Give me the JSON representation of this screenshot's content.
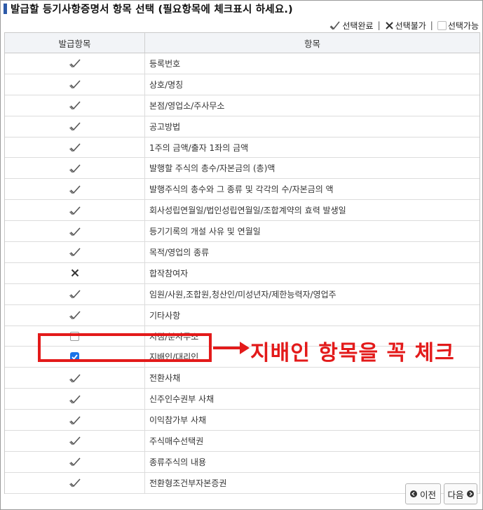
{
  "title": "발급할 등기사항증명서 항목 선택 (필요항목에 체크표시 하세요.)",
  "legend": {
    "completed": "선택완료",
    "unavailable": "선택불가",
    "available": "선택가능"
  },
  "table": {
    "headers": [
      "발급항목",
      "항목"
    ],
    "rows": [
      {
        "state": "completed",
        "label": "등록번호"
      },
      {
        "state": "completed",
        "label": "상호/명칭"
      },
      {
        "state": "completed",
        "label": "본점/영업소/주사무소"
      },
      {
        "state": "completed",
        "label": "공고방법"
      },
      {
        "state": "completed",
        "label": "1주의 금액/출자 1좌의 금액"
      },
      {
        "state": "completed",
        "label": "발행할 주식의 총수/자본금의 (총)액"
      },
      {
        "state": "completed",
        "label": "발행주식의 총수와 그 종류 및 각각의 수/자본금의 액"
      },
      {
        "state": "completed",
        "label": "회사성립연월일/법인성립연월일/조합계약의 효력 발생일"
      },
      {
        "state": "completed",
        "label": "등기기록의 개설 사유 및 연월일"
      },
      {
        "state": "completed",
        "label": "목적/영업의 종류"
      },
      {
        "state": "unavailable",
        "label": "합작참여자"
      },
      {
        "state": "completed",
        "label": "임원/사원,조합원,청산인/미성년자/제한능력자/영업주"
      },
      {
        "state": "completed",
        "label": "기타사항"
      },
      {
        "state": "available",
        "label": "지점/분사무소"
      },
      {
        "state": "checked",
        "label": "지배인/대리인"
      },
      {
        "state": "completed",
        "label": "전환사채"
      },
      {
        "state": "completed",
        "label": "신주인수권부 사채"
      },
      {
        "state": "completed",
        "label": "이익참가부 사채"
      },
      {
        "state": "completed",
        "label": "주식매수선택권"
      },
      {
        "state": "completed",
        "label": "종류주식의 내용"
      },
      {
        "state": "completed",
        "label": "전환형조건부자본증권"
      }
    ]
  },
  "annotation": "지배인 항목을 꼭 체크",
  "buttons": {
    "prev": "이전",
    "next": "다음"
  },
  "colors": {
    "accent_red": "#e31a1a",
    "checkbox_blue": "#1a73e8",
    "title_bullet": "#2d5aa8"
  }
}
